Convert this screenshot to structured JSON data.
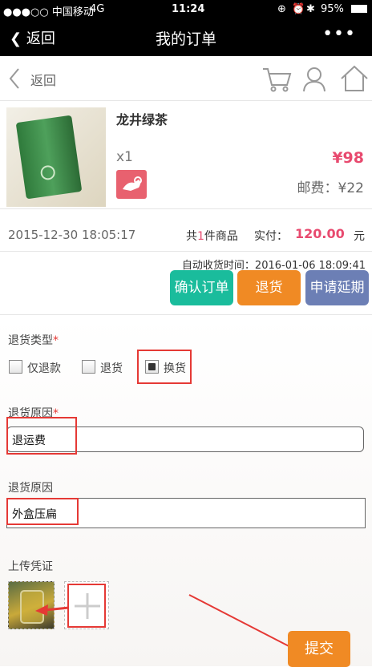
{
  "status_bar": {
    "carrier": "●●●○○ 中国移动",
    "network": "4G",
    "time": "11:24",
    "battery": "95%"
  },
  "nav": {
    "back_label": "返回",
    "title": "我的订单",
    "more_label": "•••"
  },
  "subnav": {
    "back_label": "返回",
    "icons": [
      "cart-icon",
      "user-icon",
      "home-icon"
    ]
  },
  "product": {
    "name": "龙井绿茶",
    "quantity": "x1",
    "price": "¥98",
    "shipping": "邮费：¥22"
  },
  "order": {
    "date": "2015-12-30 18:05:17",
    "count_prefix": "共",
    "count": "1",
    "count_suffix": "件商品",
    "paid_label": "实付：",
    "paid_amount": "120.00",
    "paid_unit": "元",
    "auto_receive_label": "自动收货时间：",
    "auto_receive_time": "2016-01-06 18:09:41"
  },
  "actions": {
    "confirm": "确认订单",
    "return": "退货",
    "extend": "申请延期"
  },
  "form": {
    "return_type_label": "退货类型",
    "required_mark": "*",
    "options": [
      "仅退款",
      "退货",
      "换货"
    ],
    "selected_option": "换货",
    "reason_label": "退货原因",
    "reason_value": "退运费",
    "reason2_label": "退货原因",
    "reason2_value": "外盒压扁",
    "upload_label": "上传凭证",
    "submit_label": "提交"
  },
  "colors": {
    "price": "#e84a6f",
    "confirm_btn": "#1abc9c",
    "return_btn": "#f08a24",
    "extend_btn": "#6c7fb5",
    "submit_btn": "#f08a24",
    "annotation": "#e53935"
  }
}
